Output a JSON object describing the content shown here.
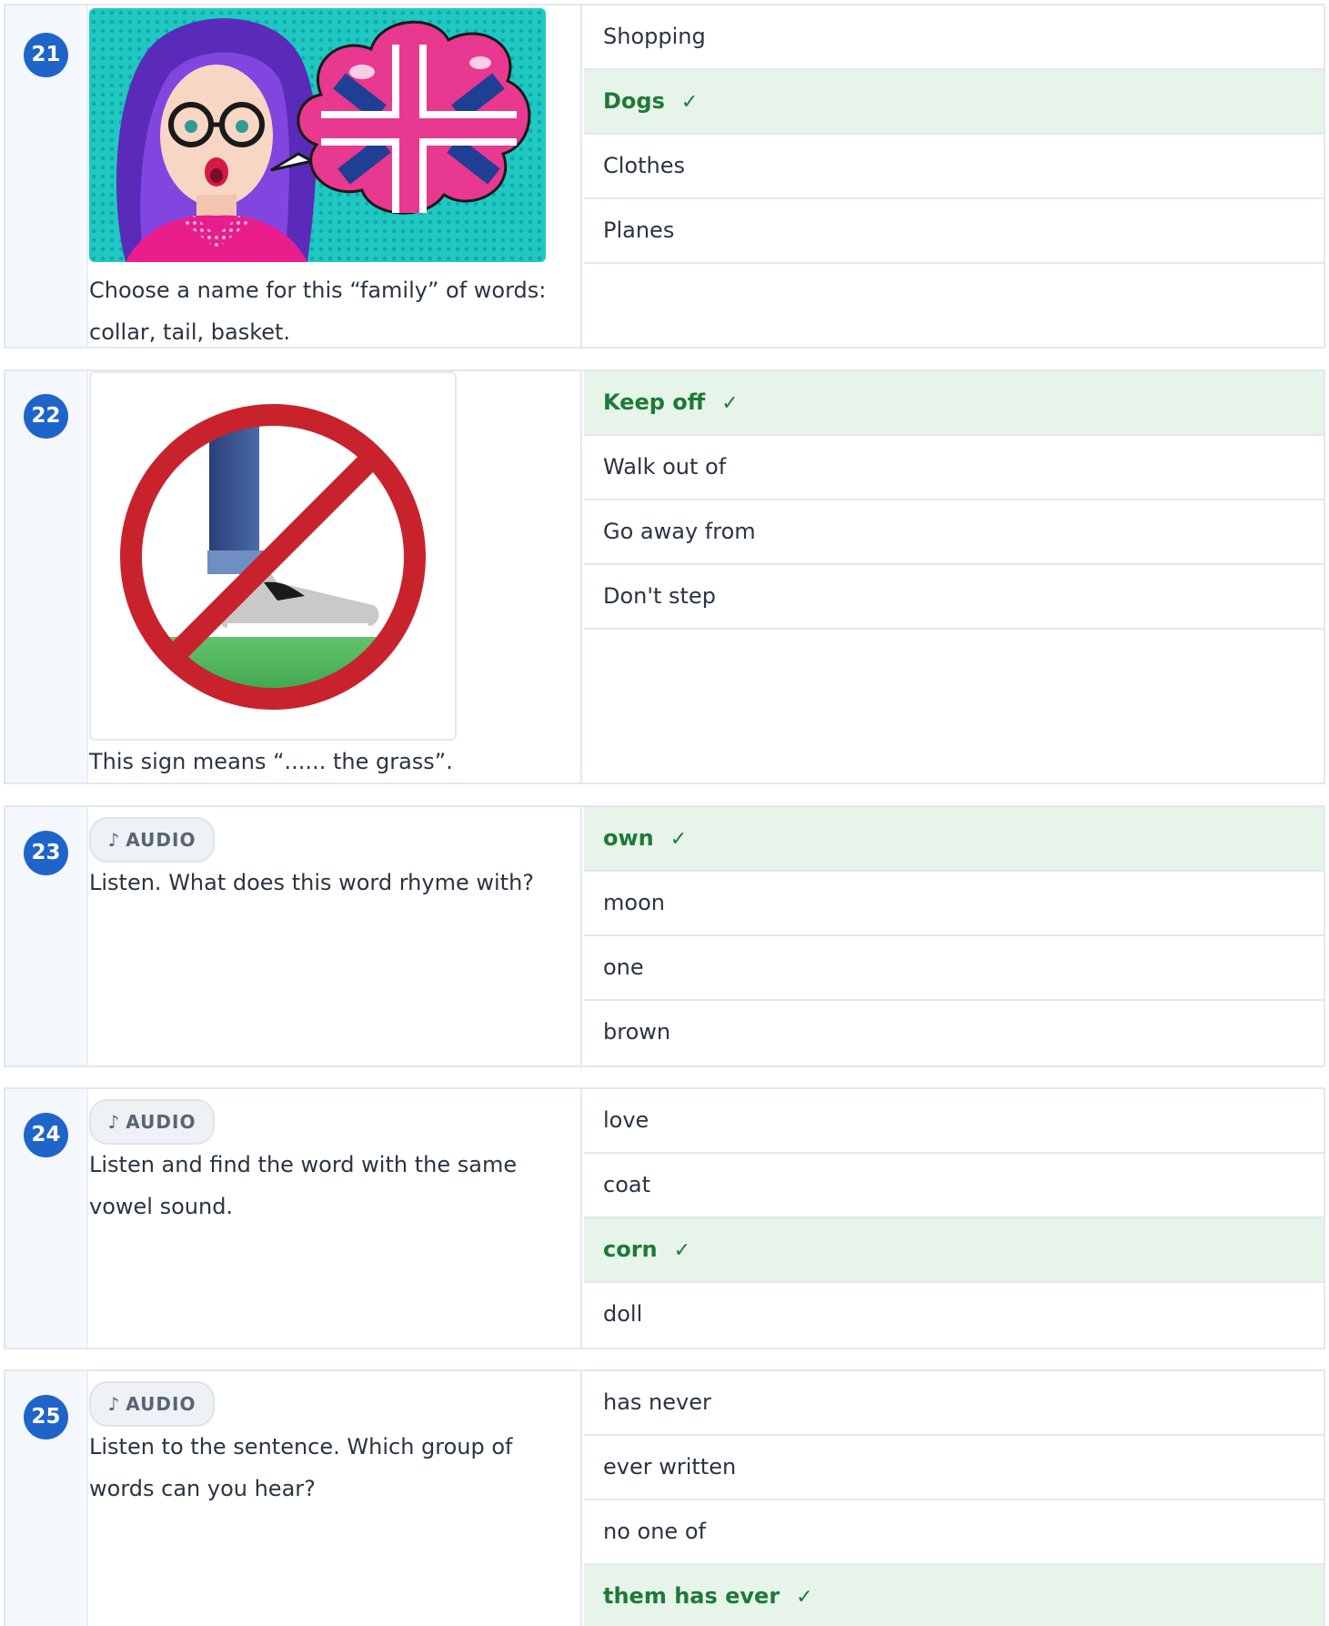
{
  "questions": [
    {
      "number": "21",
      "prompt": "Choose a name for this “family” of words: collar, tail, basket.",
      "image": "pop-art-woman-union-jack-speech-bubble",
      "options": [
        {
          "label": "Shopping",
          "correct": false
        },
        {
          "label": "Dogs",
          "correct": true
        },
        {
          "label": "Clothes",
          "correct": false
        },
        {
          "label": "Planes",
          "correct": false
        }
      ]
    },
    {
      "number": "22",
      "prompt": "This sign means “...... the grass”.",
      "image": "no-stepping-on-grass-sign",
      "options": [
        {
          "label": "Keep off",
          "correct": true
        },
        {
          "label": "Walk out of",
          "correct": false
        },
        {
          "label": "Go away from",
          "correct": false
        },
        {
          "label": "Don't step",
          "correct": false
        }
      ]
    },
    {
      "number": "23",
      "audio_label": "AUDIO",
      "prompt": "Listen. What does this word rhyme with?",
      "options": [
        {
          "label": "own",
          "correct": true
        },
        {
          "label": "moon",
          "correct": false
        },
        {
          "label": "one",
          "correct": false
        },
        {
          "label": "brown",
          "correct": false
        }
      ]
    },
    {
      "number": "24",
      "audio_label": "AUDIO",
      "prompt": "Listen and find the word with the same vowel sound.",
      "options": [
        {
          "label": "love",
          "correct": false
        },
        {
          "label": "coat",
          "correct": false
        },
        {
          "label": "corn",
          "correct": true
        },
        {
          "label": "doll",
          "correct": false
        }
      ]
    },
    {
      "number": "25",
      "audio_label": "AUDIO",
      "prompt": "Listen to the sentence. Which group of words can you hear?",
      "options": [
        {
          "label": "has never",
          "correct": false
        },
        {
          "label": "ever written",
          "correct": false
        },
        {
          "label": "no one of",
          "correct": false
        },
        {
          "label": "them has ever",
          "correct": true
        }
      ]
    }
  ],
  "icons": {
    "check": "✓",
    "note": "♪"
  },
  "colors": {
    "accent": "#1f64c9",
    "correct_bg": "#e6f4ea",
    "correct_text": "#1e7a36"
  }
}
